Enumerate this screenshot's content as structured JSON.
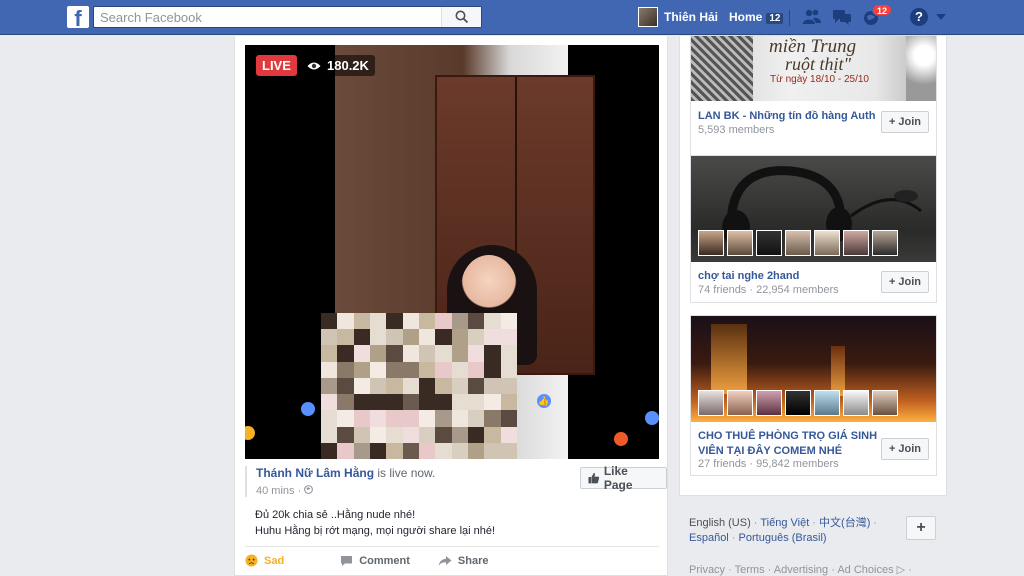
{
  "header": {
    "logo": "f",
    "search_placeholder": "Search Facebook",
    "profile_name": "Thiên Hải",
    "home_label": "Home",
    "home_count": "12",
    "notifications_count": "12",
    "help_glyph": "?"
  },
  "post": {
    "live_label": "LIVE",
    "viewer_count": "180.2K",
    "author": "Thánh Nữ Lâm Hằng",
    "status": " is live now.",
    "time": "40 mins · ",
    "like_page_label": "Like Page",
    "text_line1": "Đủ 20k chia sẻ ..Hằng nude nhé!",
    "text_line2": "Huhu Hằng bị rớt mạng, mọi người share lại nhé!",
    "actions": {
      "sad": "Sad",
      "comment": "Comment",
      "share": "Share"
    }
  },
  "groups": [
    {
      "cover_text_line1": "miền Trung",
      "cover_text_line2": "ruột thịt\"",
      "cover_text_line3": "Từ ngày 18/10 - 25/10",
      "name": "LAN BK - Những tín đồ hàng Auth",
      "sub": "5,593 members",
      "join_label": "Join"
    },
    {
      "name": "chợ tai nghe 2hand",
      "sub": "74 friends · 22,954 members",
      "join_label": "Join"
    },
    {
      "name": "CHO THUÊ PHÒNG TRỌ GIÁ SINH VIÊN TẠI ĐÂY COMEM NHÉ",
      "sub": "27 friends · 95,842 members",
      "join_label": "Join"
    }
  ],
  "footer": {
    "current_lang": "English (US)",
    "lang_sep": " · ",
    "lang_vi": "Tiếng Việt",
    "lang_zh": "中文(台灣)",
    "lang_es": "Español",
    "lang_pt": "Português (Brasil)",
    "links": "Privacy · Terms · Advertising · Ad Choices ▷ ·"
  },
  "colors": {
    "brand": "#4267b2",
    "link": "#365899",
    "live": "#e0393e"
  }
}
